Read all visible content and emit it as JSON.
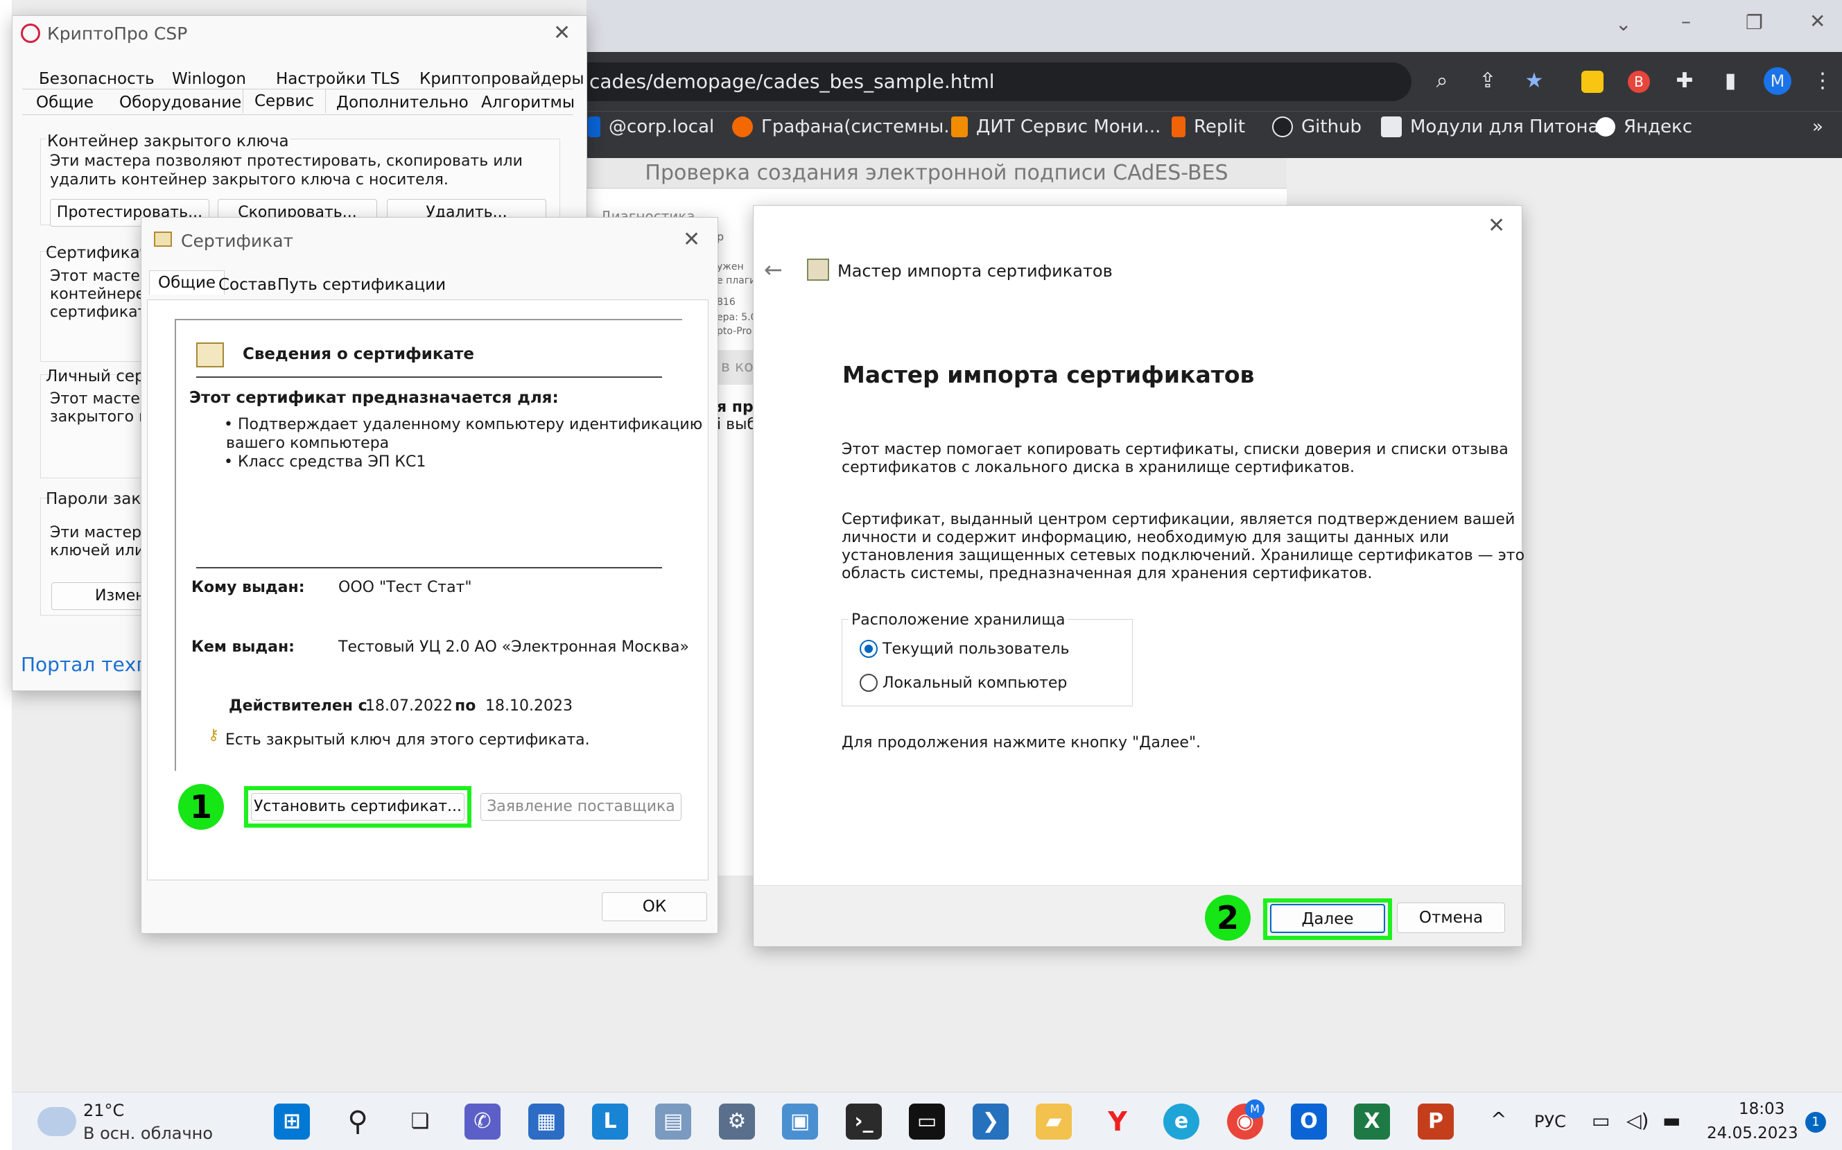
{
  "browser": {
    "url": "cades/demopage/cades_bes_sample.html",
    "profile_initial": "M",
    "bookmarks": [
      "@corp.local",
      "Графана(системны...",
      "ДИТ Сервис Мони...",
      "Replit",
      "Github",
      "Модули для Питона",
      "Яндекс"
    ],
    "more_label": "»",
    "page_title": "Проверка создания электронной подписи CAdES-BES",
    "page_fragments": [
      "Диагностика",
      "р",
      "ужен",
      "е плаги",
      "816",
      "ера: 5.0",
      "pto-Pro (",
      "в ко",
      "я про",
      "і выбо"
    ]
  },
  "cryptopro": {
    "title": "КриптоПро CSP",
    "tabs_row1": [
      "Безопасность",
      "Winlogon",
      "Настройки TLS",
      "Криптопровайдеры"
    ],
    "tabs_row2": [
      "Общие",
      "Оборудование",
      "Сервис",
      "Дополнительно",
      "Алгоритмы"
    ],
    "container_group": "Контейнер закрытого ключа",
    "container_desc": "Эти мастера позволяют протестировать, скопировать или удалить контейнер закрытого ключа с носителя.",
    "btn_test": "Протестировать...",
    "btn_copy": "Скопировать...",
    "btn_delete": "Удалить...",
    "certs_group": "Сертификаты",
    "certs_desc": [
      "Этот мастер",
      "контейнере з",
      "сертификато"
    ],
    "personal_group": "Личный серт",
    "personal_desc": [
      "Этот мастер",
      "закрытого кл"
    ],
    "pass_group": "Пароли закры",
    "pass_desc": [
      "Эти мастера",
      "ключей или у"
    ],
    "btn_change": "Измен",
    "portal_link": "Портал техпо"
  },
  "certificate": {
    "title": "Сертификат",
    "tabs": [
      "Общие",
      "Состав",
      "Путь сертификации"
    ],
    "info_heading": "Сведения о сертификате",
    "purpose_heading": "Этот сертификат предназначается для:",
    "purposes": [
      "• Подтверждает удаленному компьютеру идентификацию",
      "вашего компьютера",
      "• Класс средства ЭП КС1"
    ],
    "issued_to_label": "Кому выдан:",
    "issued_to": "ООО \"Тест Стат\"",
    "issued_by_label": "Кем выдан:",
    "issued_by": "Тестовый УЦ 2.0 АО «Электронная Москва»",
    "valid_from_label": "Действителен с",
    "valid_from": "18.07.2022",
    "valid_to_label": "по",
    "valid_to": "18.10.2023",
    "private_key_note": "Есть закрытый ключ для этого сертификата.",
    "btn_install": "Установить сертификат...",
    "btn_statement": "Заявление поставщика",
    "btn_ok": "ОК",
    "step1": "1"
  },
  "wizard": {
    "title": "Мастер импорта сертификатов",
    "heading": "Мастер импорта сертификатов",
    "para1": [
      "Этот мастер помогает копировать сертификаты, списки доверия и списки отзыва",
      "сертификатов с локального диска в хранилище сертификатов."
    ],
    "para2": [
      "Сертификат, выданный центром сертификации, является подтверждением вашей",
      "личности и содержит информацию, необходимую для защиты данных или",
      "установления защищенных сетевых подключений. Хранилище сертификатов — это",
      "область системы, предназначенная для хранения сертификатов."
    ],
    "store_group": "Расположение хранилища",
    "opt_current": "Текущий пользователь",
    "opt_local": "Локальный компьютер",
    "continue_hint": "Для продолжения нажмите кнопку \"Далее\".",
    "btn_next": "Далее",
    "btn_cancel": "Отмена",
    "step2": "2"
  },
  "taskbar": {
    "temp": "21°C",
    "weather": "В осн. облачно",
    "lang": "РУС",
    "time": "18:03",
    "date": "24.05.2023",
    "notif_count": "1",
    "chrome_badge": "M"
  },
  "colors": {
    "highlight": "#1ef01e",
    "chrome_dark": "#35363a",
    "accent": "#0067c0"
  }
}
